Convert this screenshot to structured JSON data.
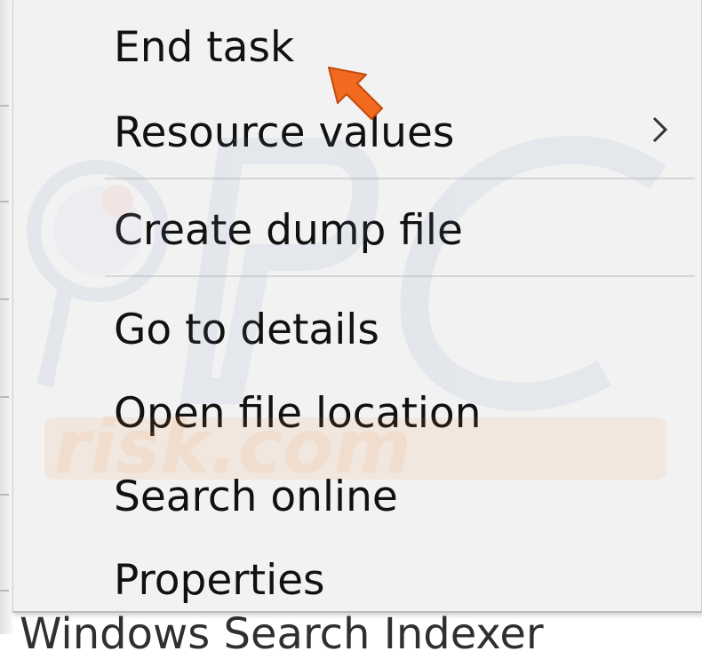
{
  "context_menu": {
    "items": [
      {
        "label": "End task"
      },
      {
        "label": "Resource values",
        "submenu_icon": "chevron-right-icon"
      },
      {
        "label": "Create dump file"
      },
      {
        "label": "Go to details"
      },
      {
        "label": "Open file location"
      },
      {
        "label": "Search online"
      },
      {
        "label": "Properties"
      }
    ]
  },
  "annotation": {
    "icon": "arrow-pointer-icon",
    "color": "#f26a1f"
  },
  "watermark": {
    "text": "risk.com",
    "logo": "PC"
  },
  "background": {
    "partial_text": "Windows Search Indexer"
  },
  "colors": {
    "menu_background": "#f2f2f2",
    "separator": "#d6d6d6",
    "text": "#111111"
  }
}
